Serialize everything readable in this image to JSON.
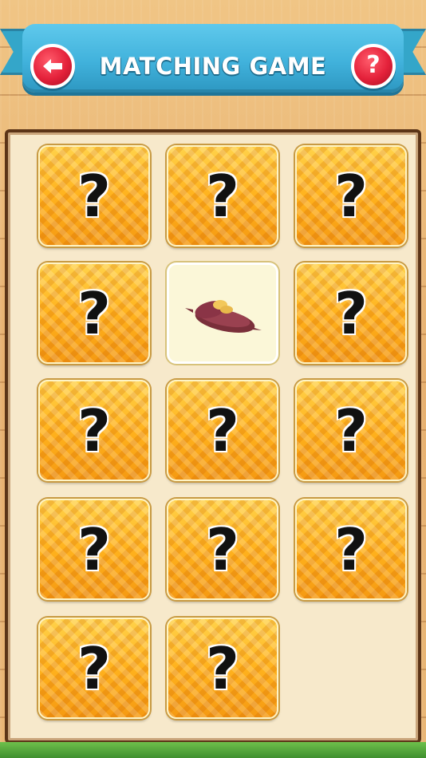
{
  "header": {
    "title": "MATCHING GAME",
    "back_icon": "arrow-left-icon",
    "back_symbol": "←",
    "help_icon": "question-icon",
    "help_symbol": "?"
  },
  "board": {
    "cards": [
      {
        "state": "hidden",
        "symbol": "?"
      },
      {
        "state": "hidden",
        "symbol": "?"
      },
      {
        "state": "hidden",
        "symbol": "?"
      },
      {
        "state": "hidden",
        "symbol": "?"
      },
      {
        "state": "revealed",
        "image": "sweet-potato"
      },
      {
        "state": "hidden",
        "symbol": "?"
      },
      {
        "state": "hidden",
        "symbol": "?"
      },
      {
        "state": "hidden",
        "symbol": "?"
      },
      {
        "state": "hidden",
        "symbol": "?"
      },
      {
        "state": "hidden",
        "symbol": "?"
      },
      {
        "state": "hidden",
        "symbol": "?"
      },
      {
        "state": "hidden",
        "symbol": "?"
      },
      {
        "state": "hidden",
        "symbol": "?"
      },
      {
        "state": "hidden",
        "symbol": "?"
      }
    ]
  },
  "colors": {
    "ribbon": "#41b2dc",
    "button": "#e4213a",
    "card_back": "#ffb21d"
  }
}
